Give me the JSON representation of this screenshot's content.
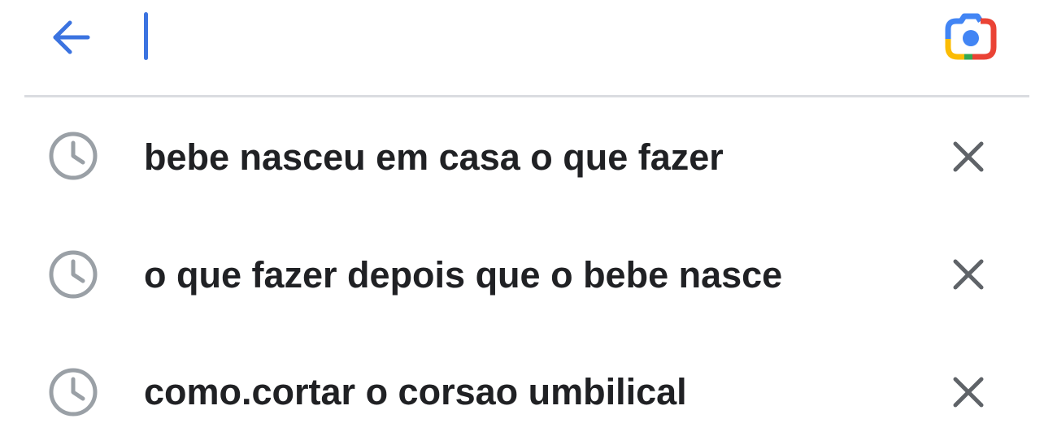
{
  "search_bar": {
    "back_icon": "arrow-back-icon",
    "query": "",
    "placeholder": "",
    "lens_icon": "google-lens-camera-icon",
    "accent_color": "#3b73e0"
  },
  "suggestions": [
    {
      "icon": "history-clock-icon",
      "text": "bebe nasceu em casa o que fazer",
      "remove_icon": "close-x-icon"
    },
    {
      "icon": "history-clock-icon",
      "text": "o que fazer depois que o bebe nasce",
      "remove_icon": "close-x-icon"
    },
    {
      "icon": "history-clock-icon",
      "text": "como.cortar o corsao umbilical",
      "remove_icon": "close-x-icon"
    }
  ],
  "colors": {
    "text": "#202124",
    "icon_gray": "#9aa0a6",
    "remove_gray": "#5f6368",
    "divider": "#dadce0",
    "lens_blue": "#4285f4",
    "lens_red": "#ea4335",
    "lens_yellow": "#fbbc04",
    "lens_green": "#34a853"
  }
}
